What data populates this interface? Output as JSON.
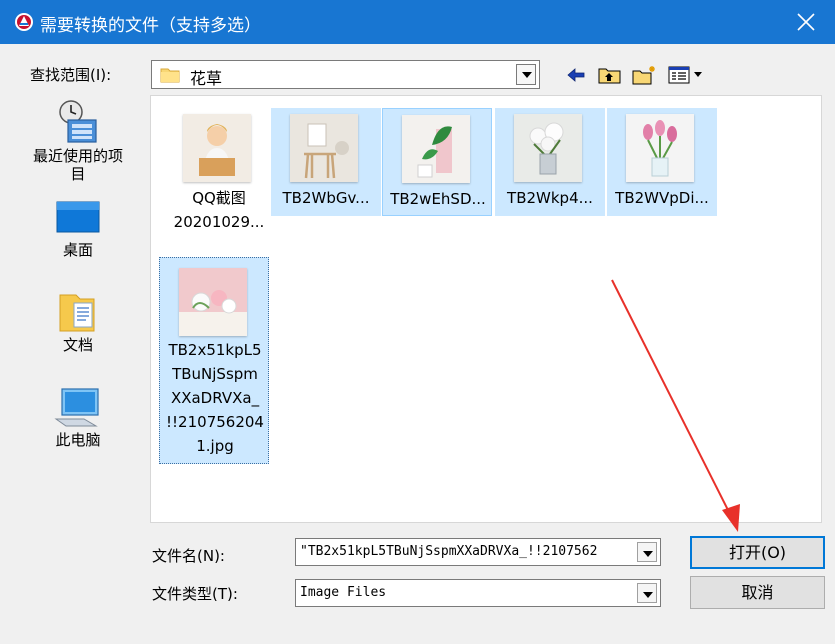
{
  "window": {
    "title": "需要转换的文件（支持多选）",
    "accent_color": "#1876d2",
    "close_icon": "close-icon"
  },
  "lookin": {
    "label": "查找范围(I):",
    "value": "花草",
    "folder_icon": "folder-icon"
  },
  "toolbar": {
    "buttons": [
      "back-arrow-icon",
      "up-folder-icon",
      "new-folder-icon",
      "view-menu-icon"
    ]
  },
  "places": [
    {
      "label": "最近使用的项目",
      "line1": "最近使用的项",
      "line2": "目",
      "icon": "recent-items-icon"
    },
    {
      "label": "桌面",
      "icon": "desktop-icon"
    },
    {
      "label": "文档",
      "icon": "documents-icon"
    },
    {
      "label": "此电脑",
      "icon": "computer-icon"
    }
  ],
  "files": [
    {
      "line1": "QQ截图",
      "line2": "20201029...",
      "selected": false
    },
    {
      "line1": "TB2WbGv...",
      "selected": true
    },
    {
      "line1": "TB2wEhSD...",
      "selected": true
    },
    {
      "line1": "TB2Wkp4...",
      "selected": true
    },
    {
      "line1": "TB2WVpDi...",
      "selected": true
    },
    {
      "lines": [
        "TB2x51kpL5",
        "TBuNjSspm",
        "XXaDRVXa_",
        "!!210756204",
        "1.jpg"
      ],
      "selected": true,
      "focused": true
    }
  ],
  "filename": {
    "label": "文件名(N):",
    "value": "\"TB2x51kpL5TBuNjSspmXXaDRVXa_!!2107562"
  },
  "filetype": {
    "label": "文件类型(T):",
    "value": "Image Files"
  },
  "buttons": {
    "open": "打开(O)",
    "cancel": "取消"
  },
  "annotation": {
    "arrow_color": "#e8312a"
  }
}
